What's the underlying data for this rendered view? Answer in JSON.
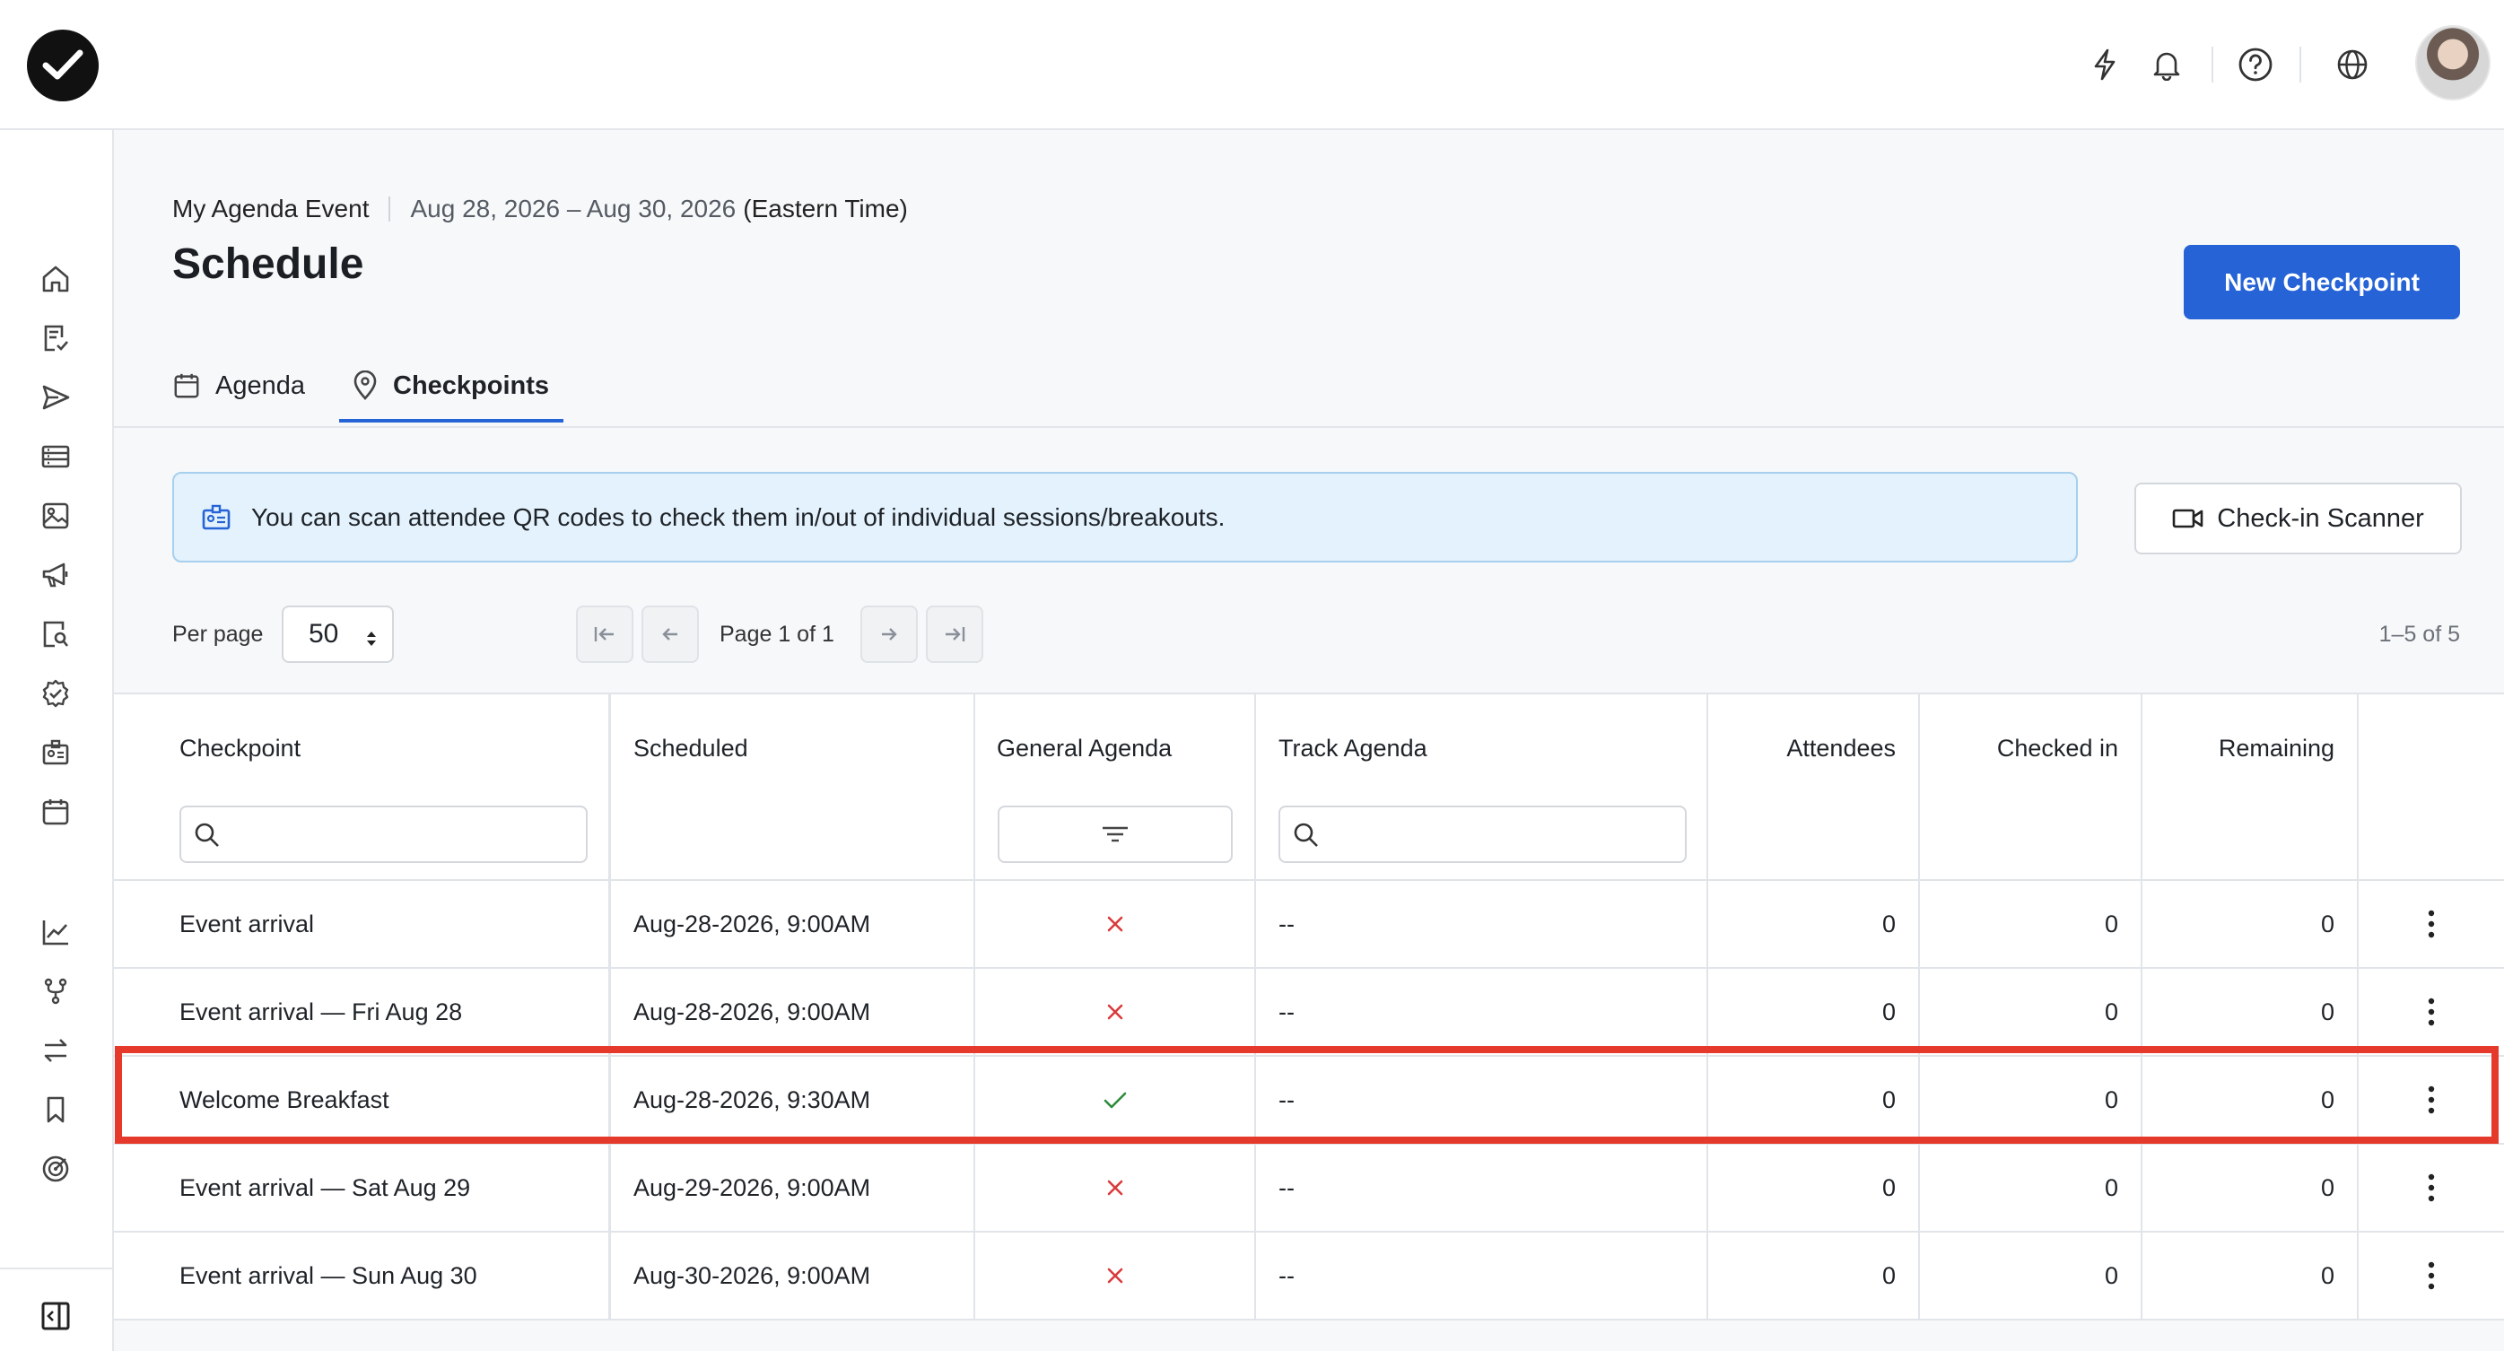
{
  "header": {
    "icons": [
      "bolt-icon",
      "bell-icon",
      "help-icon",
      "globe-icon"
    ],
    "avatar_alt": ""
  },
  "sidebar": {
    "items": [
      "home-icon",
      "form-icon",
      "send-icon",
      "list-icon",
      "image-icon",
      "megaphone-icon",
      "search-doc-icon",
      "check-circle-icon",
      "badge-icon",
      "calendar-icon",
      "chart-icon",
      "branch-icon",
      "swap-icon",
      "bookmark-icon",
      "target-icon"
    ],
    "collapse_icon": "panel-icon"
  },
  "page": {
    "event_name": "My Agenda Event",
    "dates": "Aug 28, 2026 – Aug 30, 2026",
    "timezone": "(Eastern Time)",
    "title": "Schedule",
    "new_button": "New Checkpoint"
  },
  "tabs": [
    {
      "label": "Agenda",
      "active": false
    },
    {
      "label": "Checkpoints",
      "active": true
    }
  ],
  "info": {
    "text": "You can scan attendee QR codes to check them in/out of individual sessions/breakouts.",
    "scanner_button": "Check-in Scanner"
  },
  "pagination": {
    "per_page_label": "Per page",
    "per_page_value": "50",
    "page_text": "Page 1 of 1",
    "count_text": "1–5 of 5"
  },
  "table": {
    "columns": [
      "Checkpoint",
      "Scheduled",
      "General Agenda",
      "Track Agenda",
      "Attendees",
      "Checked in",
      "Remaining"
    ],
    "rows": [
      {
        "checkpoint": "Event arrival",
        "scheduled": "Aug-28-2026, 9:00AM",
        "general": false,
        "track": "--",
        "attendees": "0",
        "checked_in": "0",
        "remaining": "0"
      },
      {
        "checkpoint": "Event arrival — Fri Aug 28",
        "scheduled": "Aug-28-2026, 9:00AM",
        "general": false,
        "track": "--",
        "attendees": "0",
        "checked_in": "0",
        "remaining": "0"
      },
      {
        "checkpoint": "Welcome Breakfast",
        "scheduled": "Aug-28-2026, 9:30AM",
        "general": true,
        "track": "--",
        "attendees": "0",
        "checked_in": "0",
        "remaining": "0"
      },
      {
        "checkpoint": "Event arrival — Sat Aug 29",
        "scheduled": "Aug-29-2026, 9:00AM",
        "general": false,
        "track": "--",
        "attendees": "0",
        "checked_in": "0",
        "remaining": "0"
      },
      {
        "checkpoint": "Event arrival — Sun Aug 30",
        "scheduled": "Aug-30-2026, 9:00AM",
        "general": false,
        "track": "--",
        "attendees": "0",
        "checked_in": "0",
        "remaining": "0"
      }
    ],
    "highlighted_row": 2
  },
  "colors": {
    "primary": "#2563d6",
    "highlight": "#e53a2b",
    "cross": "#d93a3a",
    "check": "#2e8b3a",
    "info_bg": "#e3f2fd"
  }
}
